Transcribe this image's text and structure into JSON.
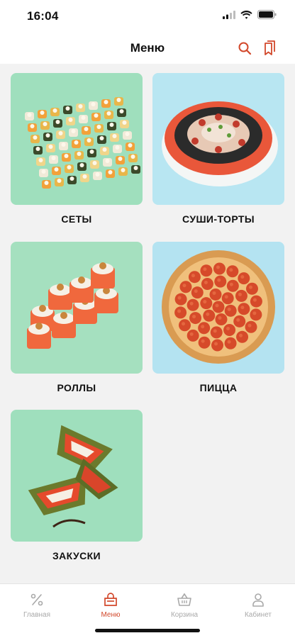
{
  "status_bar": {
    "time": "16:04"
  },
  "header": {
    "title": "Меню"
  },
  "categories": [
    {
      "label": "СЕТЫ",
      "image": "sushi-set-photo",
      "bg": "#9fdfbd"
    },
    {
      "label": "СУШИ-ТОРТЫ",
      "image": "sushi-cake-photo",
      "bg": "#b8e6f2"
    },
    {
      "label": "РОЛЛЫ",
      "image": "rolls-photo",
      "bg": "#a5e0bf"
    },
    {
      "label": "ПИЦЦА",
      "image": "pizza-photo",
      "bg": "#b4e3f1"
    },
    {
      "label": "ЗАКУСКИ",
      "image": "snacks-photo",
      "bg": "#9fdfbd"
    }
  ],
  "tab_bar": {
    "items": [
      {
        "label": "Главная",
        "icon": "percent-icon",
        "active": false
      },
      {
        "label": "Меню",
        "icon": "menu-bag-icon",
        "active": true
      },
      {
        "label": "Корзина",
        "icon": "basket-icon",
        "active": false
      },
      {
        "label": "Кабинет",
        "icon": "profile-icon",
        "active": false
      }
    ]
  },
  "colors": {
    "accent": "#d2482b",
    "inactive": "#a9a9a9",
    "background": "#f2f2f2"
  }
}
